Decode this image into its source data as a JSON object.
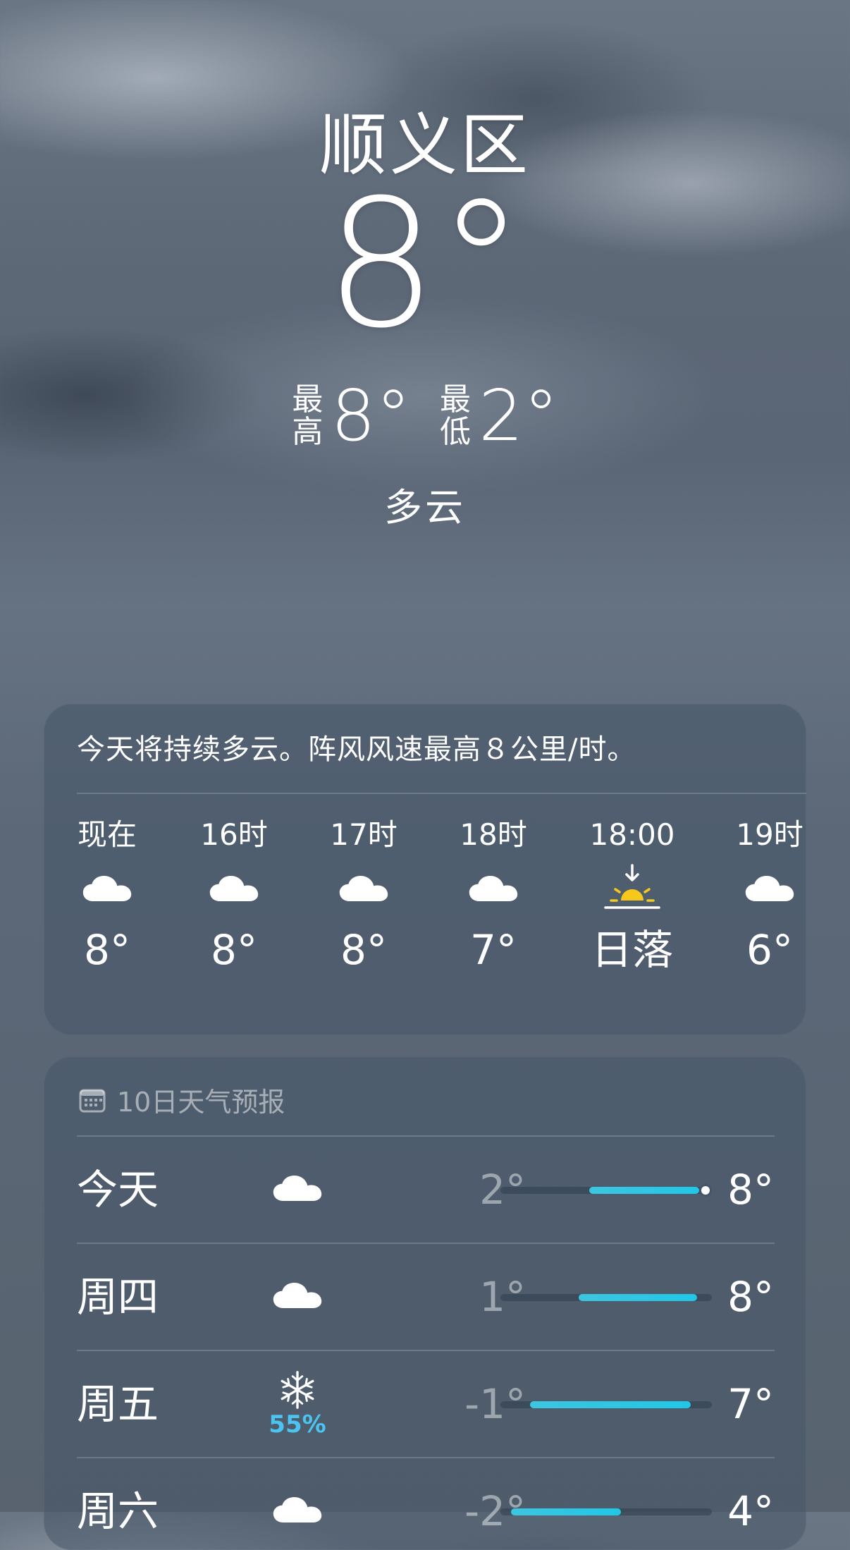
{
  "location": "顺义区",
  "current": {
    "temperature": "8°",
    "high_label": "最高",
    "high": "8°",
    "low_label": "最低",
    "low": "2°",
    "condition": "多云"
  },
  "hourly": {
    "summary": "今天将持续多云。阵风风速最高８公里/时。",
    "items": [
      {
        "label": "现在",
        "icon": "cloud-icon",
        "value": "8°"
      },
      {
        "label": "16时",
        "icon": "cloud-icon",
        "value": "8°"
      },
      {
        "label": "17时",
        "icon": "cloud-icon",
        "value": "8°"
      },
      {
        "label": "18时",
        "icon": "cloud-icon",
        "value": "7°"
      },
      {
        "label": "18:00",
        "icon": "sunset-icon",
        "value": "日落"
      },
      {
        "label": "19时",
        "icon": "cloud-icon",
        "value": "6°"
      }
    ]
  },
  "daily": {
    "title": "10日天气预报",
    "items": [
      {
        "day": "今天",
        "icon": "cloud-icon",
        "precip": "",
        "low": "2°",
        "high": "8°",
        "bar_start": 0.42,
        "bar_end": 0.94,
        "current_pos": 0.97
      },
      {
        "day": "周四",
        "icon": "cloud-icon",
        "precip": "",
        "low": "1°",
        "high": "8°",
        "bar_start": 0.37,
        "bar_end": 0.93
      },
      {
        "day": "周五",
        "icon": "snowflake-icon",
        "precip": "55%",
        "low": "-1°",
        "high": "7°",
        "bar_start": 0.14,
        "bar_end": 0.9
      },
      {
        "day": "周六",
        "icon": "cloud-icon",
        "precip": "",
        "low": "-2°",
        "high": "4°",
        "bar_start": 0.05,
        "bar_end": 0.57
      }
    ]
  },
  "colors": {
    "range_bar": "#21c7e8",
    "precip": "#4cc4f2",
    "sun": "#f7c81c"
  }
}
